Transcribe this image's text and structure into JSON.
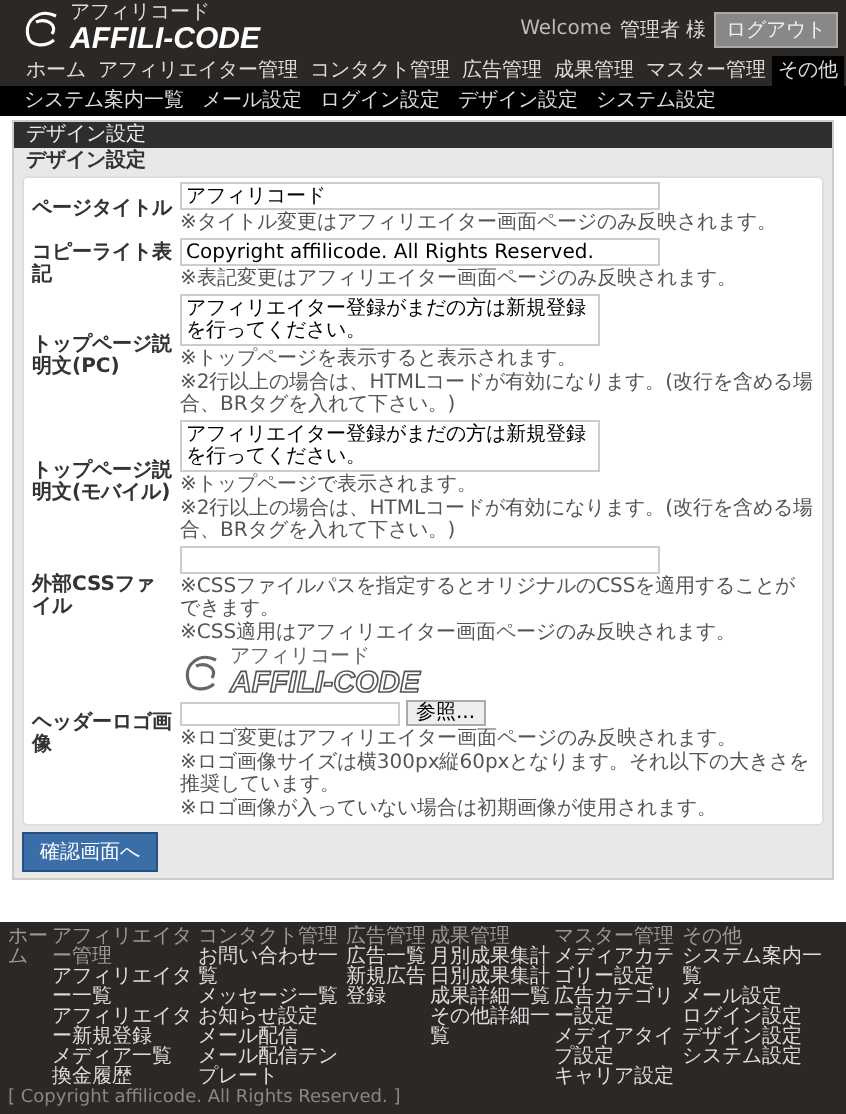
{
  "header": {
    "logo": {
      "kana": "アフィリコード",
      "name": "AFFILI-CODE"
    },
    "welcome": "Welcome",
    "user": "管理者 様",
    "logout": "ログアウト"
  },
  "nav": [
    {
      "label": "ホーム",
      "selected": false
    },
    {
      "label": "アフィリエイター管理",
      "selected": false
    },
    {
      "label": "コンタクト管理",
      "selected": false
    },
    {
      "label": "広告管理",
      "selected": false
    },
    {
      "label": "成果管理",
      "selected": false
    },
    {
      "label": "マスター管理",
      "selected": false
    },
    {
      "label": "その他",
      "selected": true
    }
  ],
  "subnav": [
    "システム案内一覧",
    "メール設定",
    "ログイン設定",
    "デザイン設定",
    "システム設定"
  ],
  "panel": {
    "title": "デザイン設定",
    "subtitle": "デザイン設定"
  },
  "fields": [
    {
      "kind": "input",
      "label": "ページタイトル",
      "value": "アフィリコード",
      "hints": [
        "※タイトル変更はアフィリエイター画面ページのみ反映されます。"
      ]
    },
    {
      "kind": "input",
      "label": "コピーライト表記",
      "value": "Copyright affilicode. All Rights Reserved.",
      "hints": [
        "※表記変更はアフィリエイター画面ページのみ反映されます。"
      ]
    },
    {
      "kind": "textarea",
      "label": "トップページ説明文(PC)",
      "value": "アフィリエイター登録がまだの方は新規登録を行ってください。",
      "hints": [
        "※トップページを表示すると表示されます。",
        "※2行以上の場合は、HTMLコードが有効になります。(改行を含める場合、BRタグを入れて下さい。)"
      ]
    },
    {
      "kind": "textarea",
      "label": "トップページ説明文(モバイル)",
      "value": "アフィリエイター登録がまだの方は新規登録を行ってください。",
      "hints": [
        "※トップページで表示されます。",
        "※2行以上の場合は、HTMLコードが有効になります。(改行を含める場合、BRタグを入れて下さい。)"
      ]
    },
    {
      "kind": "input",
      "label": "外部CSSファイル",
      "hints": [
        "※CSSファイルパスを指定するとオリジナルのCSSを適用することができます。",
        "※CSS適用はアフィリエイター画面ページのみ反映されます。"
      ]
    },
    {
      "kind": "file",
      "label": "ヘッダーロゴ画像",
      "logo": {
        "kana": "アフィリコード",
        "name": "AFFILI-CODE"
      },
      "button": "参照...",
      "hints": [
        "※ロゴ変更はアフィリエイター画面ページのみ反映されます。",
        "※ロゴ画像サイズは横300px縦60pxとなります。それ以下の大きさを推奨しています。",
        "※ロゴ画像が入っていない場合は初期画像が使用されます。"
      ]
    }
  ],
  "submit": "確認画面へ",
  "footer": {
    "columns": [
      {
        "title": "ホーム"
      },
      {
        "title": "アフィリエイター管理",
        "items": [
          "アフィリエイター一覧",
          "アフィリエイター新規登録",
          "メディア一覧",
          "換金履歴"
        ]
      },
      {
        "title": "コンタクト管理",
        "items": [
          "お問い合わせ一覧",
          "メッセージ一覧",
          "お知らせ設定",
          "メール配信",
          "メール配信テンプレート"
        ]
      },
      {
        "title": "広告管理",
        "items": [
          "広告一覧",
          "新規広告登録"
        ]
      },
      {
        "title": "成果管理",
        "items": [
          "月別成果集計",
          "日別成果集計",
          "成果詳細一覧",
          "その他詳細一覧"
        ]
      },
      {
        "title": "マスター管理",
        "items": [
          "メディアカテゴリー設定",
          "広告カテゴリー設定",
          "メディアタイプ設定",
          "キャリア設定"
        ]
      },
      {
        "title": "その他",
        "items": [
          "システム案内一覧",
          "メール設定",
          "ログイン設定",
          "デザイン設定",
          "システム設定"
        ]
      }
    ],
    "copyright": "[ Copyright affilicode. All Rights Reserved. ]"
  }
}
